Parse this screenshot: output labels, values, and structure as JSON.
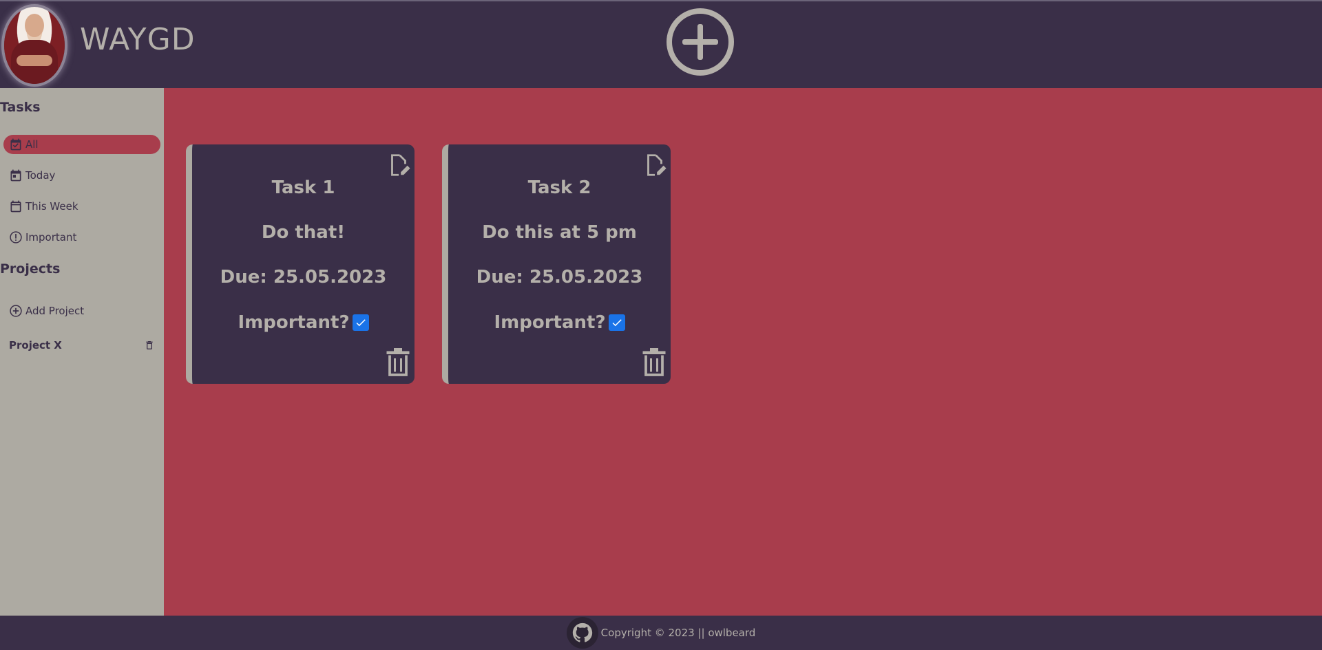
{
  "header": {
    "app_title": "WAYGD",
    "add_task_icon": "add-circle-icon"
  },
  "sidebar": {
    "tasks_heading": "Tasks",
    "nav": [
      {
        "label": "All",
        "icon": "calendar-check-icon",
        "active": true
      },
      {
        "label": "Today",
        "icon": "calendar-today-icon",
        "active": false
      },
      {
        "label": "This Week",
        "icon": "calendar-week-icon",
        "active": false
      },
      {
        "label": "Important",
        "icon": "important-icon",
        "active": false
      }
    ],
    "projects_heading": "Projects",
    "add_project_label": "Add Project",
    "projects": [
      {
        "name": "Project X"
      }
    ]
  },
  "tasks": [
    {
      "title": "Task 1",
      "description": "Do that!",
      "due": "Due: 25.05.2023",
      "important_label": "Important?",
      "important": true
    },
    {
      "title": "Task 2",
      "description": "Do this at 5 pm",
      "due": "Due: 25.05.2023",
      "important_label": "Important?",
      "important": true
    }
  ],
  "footer": {
    "copyright": "Copyright © 2023 || owlbeard"
  },
  "colors": {
    "header_bg": "#3a2f48",
    "sidebar_bg": "#adaaa2",
    "main_bg": "#a83d4c",
    "card_bg": "#3a2f48",
    "text_light": "#b4b0aa",
    "checkbox": "#1a73e8"
  }
}
